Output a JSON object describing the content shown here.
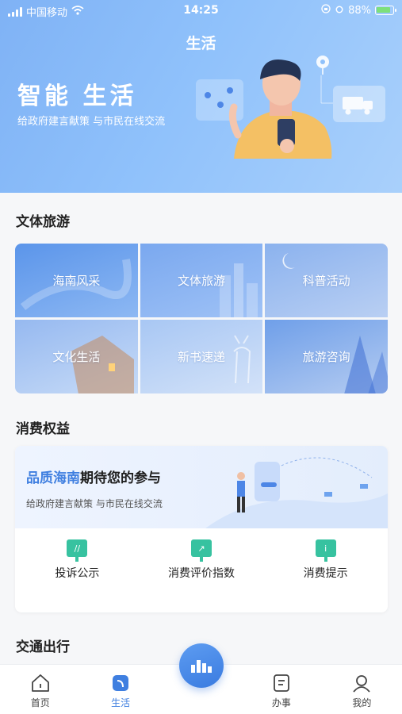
{
  "status_bar": {
    "carrier": "中国移动",
    "time": "14:25",
    "battery": "88%"
  },
  "header": {
    "title": "生活",
    "hero_heading": "智能 生活",
    "hero_subtitle": "给政府建言献策 与市民在线交流"
  },
  "sections": {
    "culture": {
      "title": "文体旅游",
      "tiles": [
        "海南风采",
        "文体旅游",
        "科普活动",
        "文化生活",
        "新书速递",
        "旅游咨询"
      ]
    },
    "consumer": {
      "title": "消费权益",
      "banner_highlight": "品质海南",
      "banner_title_rest": "期待您的参与",
      "banner_subtitle": "给政府建言献策 与市民在线交流",
      "services": [
        "投诉公示",
        "消费评价指数",
        "消费提示"
      ]
    },
    "traffic": {
      "title": "交通出行"
    }
  },
  "bottom_nav": {
    "items": [
      "首页",
      "生活",
      "办事",
      "我的"
    ],
    "active_index": 1
  },
  "colors": {
    "accent": "#3f7fe0",
    "service_icon": "#37c2a0",
    "hero": "#8fc1fb"
  }
}
